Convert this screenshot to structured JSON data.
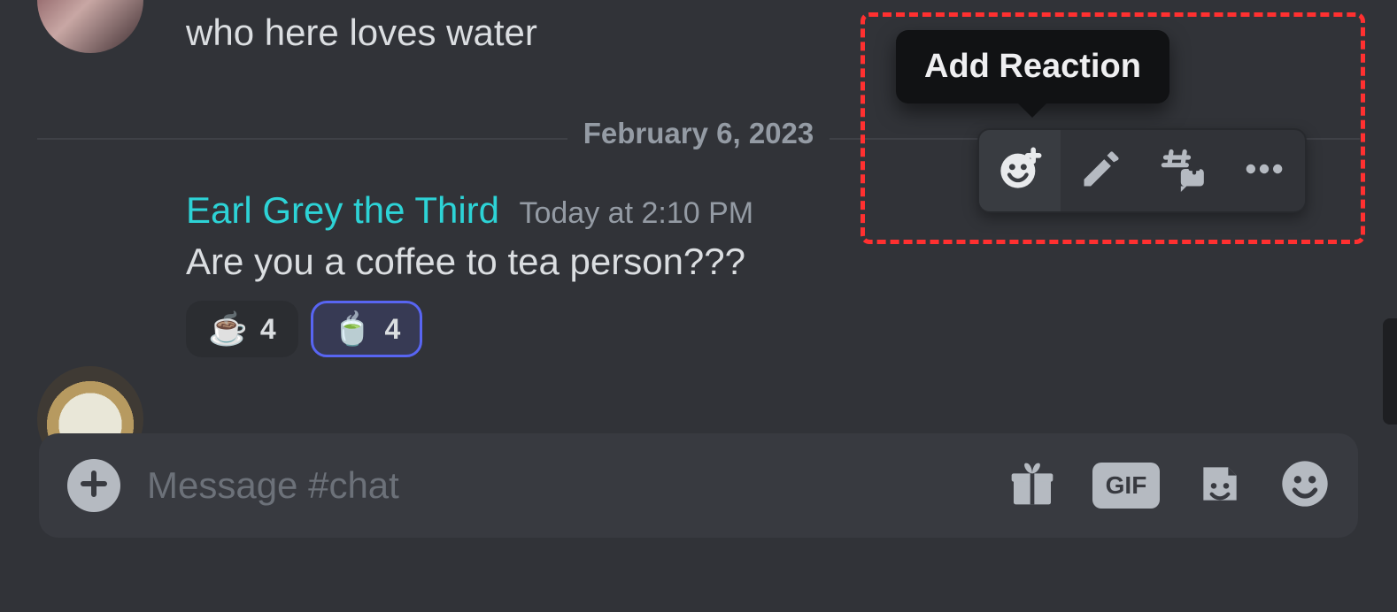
{
  "messages": {
    "prev": {
      "text": "who here loves water"
    },
    "divider_date": "February 6, 2023",
    "current": {
      "author": "Earl Grey the Third",
      "timestamp": "Today at 2:10 PM",
      "text": "Are you a coffee to tea person???",
      "reactions": [
        {
          "emoji": "☕",
          "count": "4",
          "selected": false
        },
        {
          "emoji": "🍵",
          "count": "4",
          "selected": true
        }
      ]
    }
  },
  "tooltip": {
    "label": "Add Reaction"
  },
  "composer": {
    "placeholder": "Message #chat"
  },
  "icons": {
    "add_reaction": "add-reaction-icon",
    "edit": "pencil-icon",
    "thread": "thread-icon",
    "more": "more-icon",
    "attach": "plus-icon",
    "gift": "gift-icon",
    "gif": "GIF",
    "sticker": "sticker-icon",
    "emoji": "emoji-icon"
  }
}
